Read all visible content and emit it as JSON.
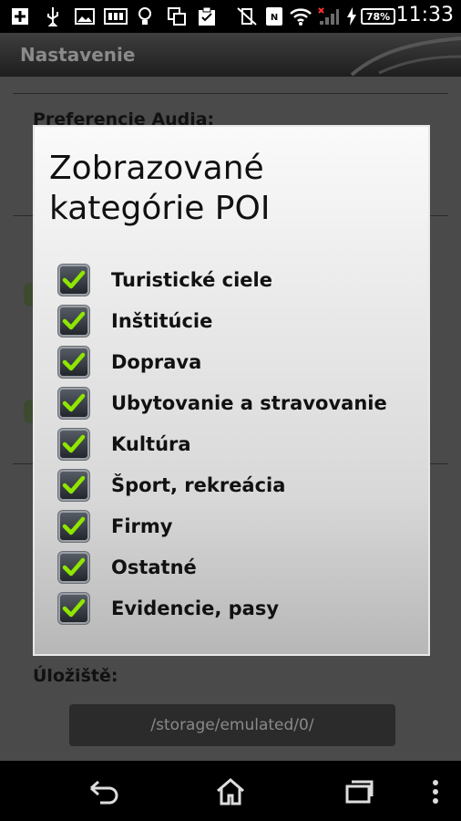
{
  "status_bar": {
    "time": "11:33",
    "battery": "78%",
    "icons": [
      "add-icon",
      "usb-icon",
      "image-icon",
      "sd-card-icon",
      "lightbulb-icon",
      "copy-icon",
      "clipboard-icon",
      "no-vibrate-icon",
      "nfc-icon",
      "wifi-icon",
      "signal-icon",
      "charging-icon"
    ]
  },
  "app_bar": {
    "title": "Nastavenie"
  },
  "background": {
    "audio_heading": "Preferencie Audia:",
    "storage_heading": "Úložiště:",
    "storage_path": "/storage/emulated/0/"
  },
  "dialog": {
    "title": "Zobrazované kategórie POI",
    "items": [
      {
        "label": "Turistické ciele",
        "checked": true
      },
      {
        "label": "Inštitúcie",
        "checked": true
      },
      {
        "label": "Doprava",
        "checked": true
      },
      {
        "label": "Ubytovanie a stravovanie",
        "checked": true
      },
      {
        "label": "Kultúra",
        "checked": true
      },
      {
        "label": "Šport, rekreácia",
        "checked": true
      },
      {
        "label": "Firmy",
        "checked": true
      },
      {
        "label": "Ostatné",
        "checked": true
      },
      {
        "label": "Evidencie, pasy",
        "checked": true
      }
    ],
    "check_color": "#8fe600"
  },
  "nav_bar": {
    "icons": [
      "back-icon",
      "home-icon",
      "recent-apps-icon",
      "overflow-menu-icon"
    ]
  }
}
